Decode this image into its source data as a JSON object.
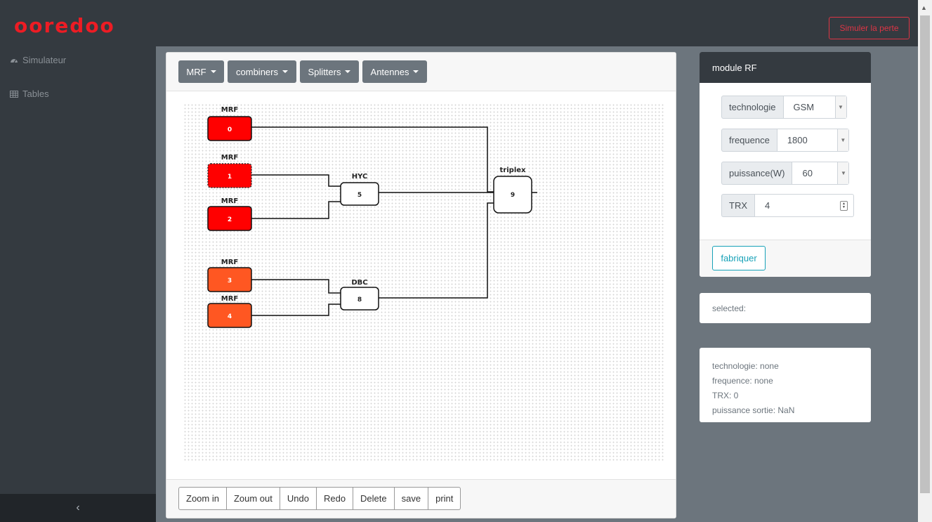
{
  "brand": {
    "logo_text": "ooredoo",
    "logo_color": "#ed1c24"
  },
  "header": {
    "simulate_button": "Simuler la perte"
  },
  "sidebar": {
    "items": [
      {
        "label": "Simulateur",
        "icon": "dashboard-icon"
      },
      {
        "label": "Tables",
        "icon": "table-icon"
      }
    ],
    "collapse_label": "‹"
  },
  "toolbar": {
    "dropdowns": [
      {
        "label": "MRF"
      },
      {
        "label": "combiners"
      },
      {
        "label": "Splitters"
      },
      {
        "label": "Antennes"
      }
    ]
  },
  "diagram": {
    "nodes": [
      {
        "id": "0",
        "label": "MRF",
        "color": "#ff0000"
      },
      {
        "id": "1",
        "label": "MRF",
        "color": "#ff0000"
      },
      {
        "id": "2",
        "label": "MRF",
        "color": "#ff0000"
      },
      {
        "id": "3",
        "label": "MRF",
        "color": "#ff5722"
      },
      {
        "id": "4",
        "label": "MRF",
        "color": "#ff5722"
      },
      {
        "id": "5",
        "label": "HYC",
        "color": "#ffffff"
      },
      {
        "id": "8",
        "label": "DBC",
        "color": "#ffffff"
      },
      {
        "id": "9",
        "label": "triplex",
        "color": "#ffffff"
      }
    ],
    "links": [
      {
        "from": "0",
        "to": "9"
      },
      {
        "from": "1",
        "to": "5"
      },
      {
        "from": "2",
        "to": "5"
      },
      {
        "from": "5",
        "to": "9"
      },
      {
        "from": "3",
        "to": "8"
      },
      {
        "from": "4",
        "to": "8"
      },
      {
        "from": "8",
        "to": "9"
      }
    ]
  },
  "footer_buttons": [
    "Zoom in",
    "Zoum out",
    "Undo",
    "Redo",
    "Delete",
    "save",
    "print"
  ],
  "rf_module": {
    "title": "module RF",
    "technologie": {
      "label": "technologie",
      "value": "GSM"
    },
    "frequence": {
      "label": "frequence",
      "value": "1800"
    },
    "puissance": {
      "label": "puissance(W)",
      "value": "60"
    },
    "trx": {
      "label": "TRX",
      "value": "4"
    },
    "submit": "fabriquer"
  },
  "selected": {
    "label": "selected:"
  },
  "info": {
    "technologie": "technologie: none",
    "frequence": "frequence: none",
    "trx": "TRX: 0",
    "puissance": "puissance sortie: NaN"
  },
  "colors": {
    "danger": "#dc3545",
    "info": "#17a2b8",
    "dark": "#343a40",
    "secondary": "#6c757d"
  }
}
